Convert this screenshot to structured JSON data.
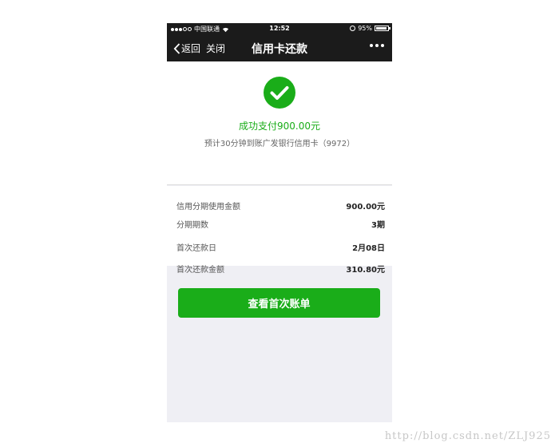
{
  "status_bar": {
    "carrier": "中国联通",
    "time": "12:52",
    "battery": "95%",
    "battery_level": 0.95
  },
  "nav": {
    "back_label": "返回",
    "close_label": "关闭",
    "title": "信用卡还款"
  },
  "success": {
    "title": "成功支付900.00元",
    "subtitle": "预计30分钟到账广发银行信用卡（9972）",
    "accent_color": "#1aad19"
  },
  "details": [
    {
      "label": "信用分期使用金额",
      "value": "900.00元"
    },
    {
      "label": "分期期数",
      "value": "3期"
    },
    {
      "label": "首次还款日",
      "value": "2月08日"
    },
    {
      "label": "首次还款金额",
      "value": "310.80元"
    }
  ],
  "action": {
    "button_label": "查看首次账单"
  },
  "watermark": "http://blog.csdn.net/ZLJ925"
}
